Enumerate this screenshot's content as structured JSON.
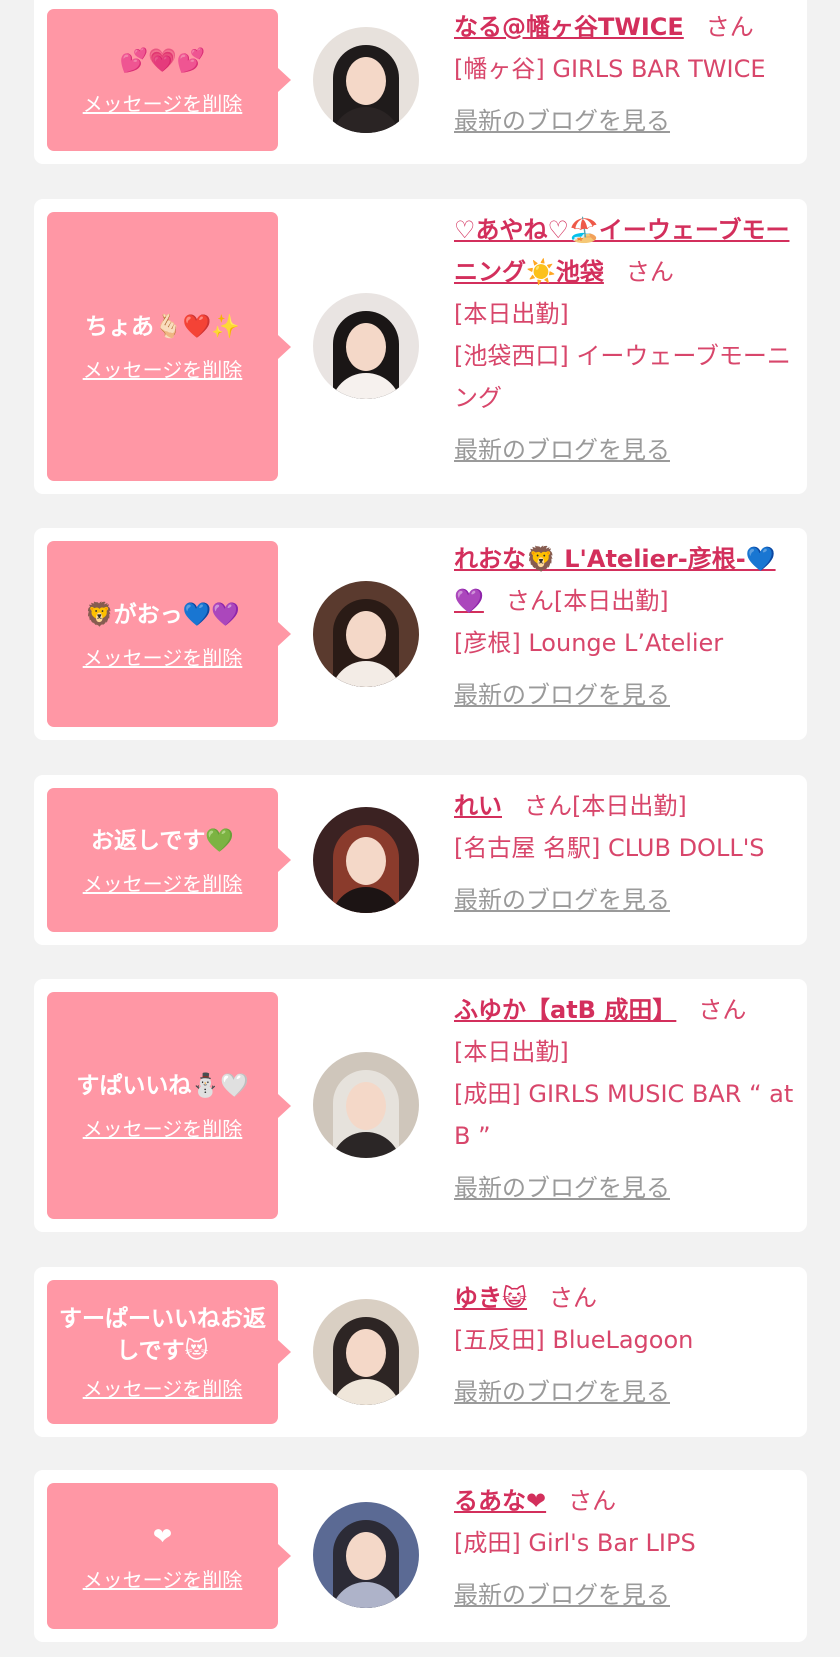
{
  "items": [
    {
      "message": "💕💗💕",
      "delete_label": "メッセージを削除",
      "name": "なる@幡ヶ谷TWICE",
      "suffix": "さん",
      "lines": [
        "[幡ヶ谷] GIRLS BAR TWICE"
      ],
      "blog_label": "最新のブログを見る",
      "colors": {
        "bg": "#e7e1dc",
        "hair": "#1f1b1b",
        "body": "#2a2424"
      }
    },
    {
      "message": "ちょあ🫰🏻❤️✨",
      "delete_label": "メッセージを削除",
      "name": "♡あやね♡🏖️イーウェーブモーニング☀️池袋",
      "suffix": "さん",
      "lines": [
        "[本日出勤]",
        "[池袋西口] イーウェーブモーニング"
      ],
      "blog_label": "最新のブログを見る",
      "colors": {
        "bg": "#e9e4e2",
        "hair": "#1a1616",
        "body": "#f6f1ee"
      }
    },
    {
      "message": "🦁がおっ💙💜",
      "delete_label": "メッセージを削除",
      "name": "れおな🦁 L'Atelier-彦根-💙💜",
      "suffix": "さん[本日出勤]",
      "lines": [
        "[彦根] Lounge L’Atelier"
      ],
      "blog_label": "最新のブログを見る",
      "colors": {
        "bg": "#5a3a2e",
        "hair": "#2a1b16",
        "body": "#f3ece6"
      }
    },
    {
      "message": "お返しです💚",
      "delete_label": "メッセージを削除",
      "name": "れい",
      "suffix": "さん[本日出勤]",
      "lines": [
        "[名古屋 名駅] CLUB DOLL'S"
      ],
      "blog_label": "最新のブログを見る",
      "colors": {
        "bg": "#3b2222",
        "hair": "#8a3b2c",
        "body": "#1c1414"
      }
    },
    {
      "message": "すぱいいね⛄️🤍",
      "delete_label": "メッセージを削除",
      "name": "ふゆか【atB 成田】",
      "suffix": "さん",
      "lines": [
        "[本日出勤]",
        "[成田] GIRLS MUSIC BAR “ at B ”"
      ],
      "blog_label": "最新のブログを見る",
      "colors": {
        "bg": "#cfc6bb",
        "hair": "#e6e2dc",
        "body": "#2b2626"
      }
    },
    {
      "message": "すーぱーいいねお返しです😻",
      "delete_label": "メッセージを削除",
      "name": "ゆき😺",
      "suffix": "さん",
      "lines": [
        "[五反田] BlueLagoon"
      ],
      "blog_label": "最新のブログを見る",
      "colors": {
        "bg": "#d9cfc3",
        "hair": "#2d2524",
        "body": "#efe6da"
      }
    },
    {
      "message": "❤",
      "delete_label": "メッセージを削除",
      "name": "るあな❤",
      "suffix": "さん",
      "lines": [
        "[成田] Girl's Bar LIPS"
      ],
      "blog_label": "最新のブログを見る",
      "colors": {
        "bg": "#5b6a94",
        "hair": "#2c2b36",
        "body": "#aeb3c9"
      }
    }
  ]
}
